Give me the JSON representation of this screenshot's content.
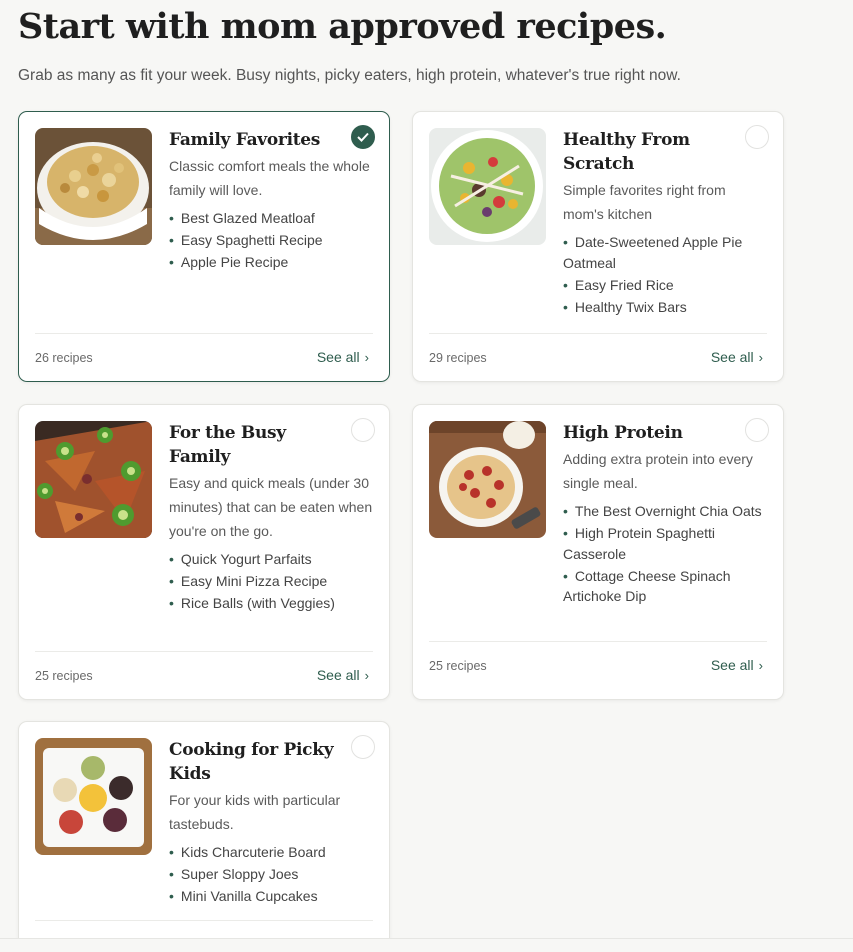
{
  "header": {
    "title": "Start with mom approved recipes.",
    "subtitle": "Grab as many as fit your week. Busy nights, picky eaters, high protein, whatever's true right now."
  },
  "colors": {
    "accent": "#2f5d4e",
    "card_border": "#e4e4e0"
  },
  "cards": [
    {
      "title": "Family Favorites",
      "description": "Classic comfort meals the whole family will love.",
      "items": [
        "Best Glazed Meatloaf",
        "Easy Spaghetti Recipe",
        "Apple Pie Recipe"
      ],
      "count": "26 recipes",
      "see_all": "See all",
      "selected": true,
      "image": "mac-and-cheese-photo"
    },
    {
      "title": "Healthy From Scratch",
      "description": "Simple favorites right from mom's kitchen",
      "items": [
        "Date-Sweetened Apple Pie Oatmeal",
        "Easy Fried Rice",
        "Healthy Twix Bars"
      ],
      "count": "29 recipes",
      "see_all": "See all",
      "selected": false,
      "image": "salad-bowl-photo"
    },
    {
      "title": "For the Busy Family",
      "description": "Easy and quick meals (under 30 minutes) that can be eaten when you're on the go.",
      "items": [
        "Quick Yogurt Parfaits",
        "Easy Mini Pizza Recipe",
        "Rice Balls (with Veggies)"
      ],
      "count": "25 recipes",
      "see_all": "See all",
      "selected": false,
      "image": "nachos-jalapeno-photo"
    },
    {
      "title": "High Protein",
      "description": "Adding extra protein into every single meal.",
      "items": [
        "The Best Overnight Chia Oats",
        "High Protein Spaghetti Casserole",
        "Cottage Cheese Spinach Artichoke Dip"
      ],
      "count": "25 recipes",
      "see_all": "See all",
      "selected": false,
      "image": "pepperoni-casserole-photo"
    },
    {
      "title": "Cooking for Picky Kids",
      "description": "For your kids with particular tastebuds.",
      "items": [
        "Kids Charcuterie Board",
        "Super Sloppy Joes",
        "Mini Vanilla Cupcakes"
      ],
      "count": "",
      "see_all": "",
      "selected": false,
      "image": "snack-plate-photo"
    }
  ]
}
